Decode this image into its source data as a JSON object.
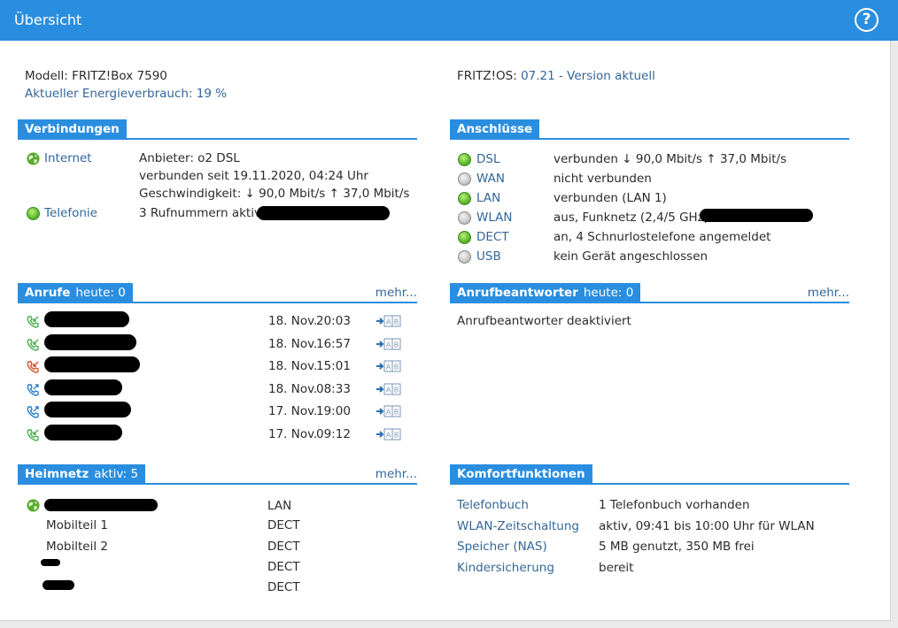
{
  "header": {
    "title": "Übersicht",
    "help": "?"
  },
  "device": {
    "model": "Modell: FRITZ!Box 7590",
    "energy": "Aktueller Energieverbrauch: 19 %",
    "os_label": "FRITZ!OS:",
    "os_value": "07.21 - Version aktuell"
  },
  "verbindungen": {
    "title": "Verbindungen",
    "internet": {
      "label": "Internet",
      "line1": "Anbieter: o2 DSL",
      "line2": "verbunden seit 19.11.2020, 04:24 Uhr",
      "line3": "Geschwindigkeit: ↓ 90,0 Mbit/s ↑ 37,0 Mbit/s"
    },
    "telefonie": {
      "label": "Telefonie",
      "value": "3 Rufnummern aktiv:"
    }
  },
  "anschluesse": {
    "title": "Anschlüsse",
    "items": [
      {
        "label": "DSL",
        "value": "verbunden ↓ 90,0 Mbit/s ↑ 37,0 Mbit/s",
        "status": "green"
      },
      {
        "label": "WAN",
        "value": "nicht verbunden",
        "status": "grey"
      },
      {
        "label": "LAN",
        "value": "verbunden (LAN 1)",
        "status": "green"
      },
      {
        "label": "WLAN",
        "value": "aus, Funknetz (2,4/5 GHz):",
        "status": "grey"
      },
      {
        "label": "DECT",
        "value": "an, 4 Schnurlostelefone angemeldet",
        "status": "green"
      },
      {
        "label": "USB",
        "value": "kein Gerät angeschlossen",
        "status": "grey"
      }
    ]
  },
  "anrufe": {
    "title": "Anrufe",
    "count": "heute: 0",
    "more": "mehr...",
    "calls": [
      {
        "type": "incoming",
        "date": "18. Nov.",
        "time": "20:03"
      },
      {
        "type": "incoming",
        "date": "18. Nov.",
        "time": "16:57"
      },
      {
        "type": "missed",
        "date": "18. Nov.",
        "time": "15:01"
      },
      {
        "type": "outgoing",
        "date": "18. Nov.",
        "time": "08:33"
      },
      {
        "type": "outgoing",
        "date": "17. Nov.",
        "time": "19:00"
      },
      {
        "type": "incoming",
        "date": "17. Nov.",
        "time": "09:12"
      }
    ]
  },
  "anrufbeantworter": {
    "title": "Anrufbeantworter",
    "count": "heute: 0",
    "more": "mehr...",
    "status": "Anrufbeantworter deaktiviert"
  },
  "heimnetz": {
    "title": "Heimnetz",
    "count": "aktiv: 5",
    "more": "mehr...",
    "devices": [
      {
        "name": "",
        "type": "LAN"
      },
      {
        "name": "Mobilteil 1",
        "type": "DECT"
      },
      {
        "name": "Mobilteil 2",
        "type": "DECT"
      },
      {
        "name": "",
        "type": "DECT"
      },
      {
        "name": "",
        "type": "DECT"
      }
    ]
  },
  "komfort": {
    "title": "Komfortfunktionen",
    "items": [
      {
        "label": "Telefonbuch",
        "value": "1 Telefonbuch vorhanden"
      },
      {
        "label": "WLAN-Zeitschaltung",
        "value": "aktiv, 09:41 bis 10:00 Uhr für WLAN"
      },
      {
        "label": "Speicher (NAS)",
        "value": "5 MB genutzt, 350 MB frei"
      },
      {
        "label": "Kindersicherung",
        "value": "bereit"
      }
    ]
  },
  "colors": {
    "accent": "#2a8ee0",
    "link": "#336699",
    "led_green": "#5cb82b",
    "led_grey": "#c8c8c8",
    "missed": "#d9532b",
    "incoming": "#4caf50",
    "outgoing": "#2a7fc9"
  }
}
